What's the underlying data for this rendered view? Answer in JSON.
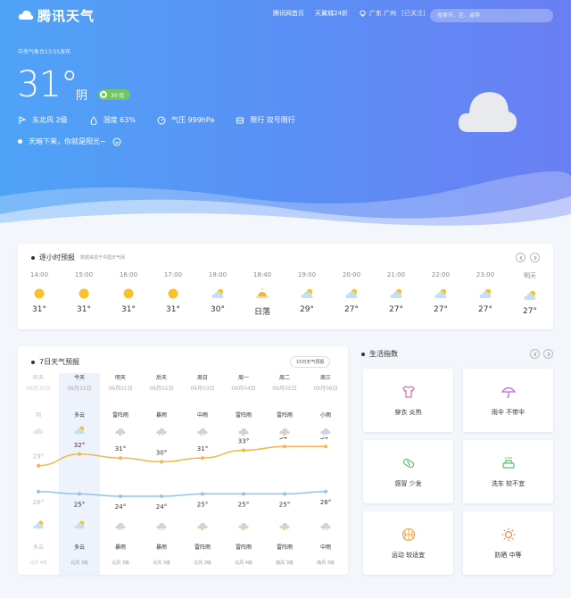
{
  "header": {
    "logo": "腾讯天气",
    "nav": [
      "腾讯网首页",
      "天翼城24折"
    ],
    "location": "广东 广州",
    "followed": "[已关注]",
    "search_placeholder": "搜索市、区、县等"
  },
  "current": {
    "published": "中央气象台13:55发布",
    "temperature": "31°",
    "condition": "阴",
    "aqi": "30 优",
    "wind": "东北风 2级",
    "humidity": "湿度 63%",
    "pressure": "气压 999hPa",
    "limit": "限行 双号限行",
    "tip": "天暗下来，你就是阳光~"
  },
  "hourly": {
    "title": "逐小时预报",
    "source": "数据来源于中国天气网",
    "hours": [
      {
        "time": "14:00",
        "icon": "sun-icon",
        "temp": "31°"
      },
      {
        "time": "15:00",
        "icon": "sun-icon",
        "temp": "31°"
      },
      {
        "time": "16:00",
        "icon": "sun-icon",
        "temp": "31°"
      },
      {
        "time": "17:00",
        "icon": "sun-icon",
        "temp": "31°"
      },
      {
        "time": "18:00",
        "icon": "partly-cloudy-icon",
        "temp": "30°"
      },
      {
        "time": "18:40",
        "icon": "sunset-icon",
        "temp": "日落"
      },
      {
        "time": "19:00",
        "icon": "partly-cloudy-icon",
        "temp": "29°"
      },
      {
        "time": "20:00",
        "icon": "partly-cloudy-icon",
        "temp": "27°"
      },
      {
        "time": "21:00",
        "icon": "partly-cloudy-icon",
        "temp": "27°"
      },
      {
        "time": "22:00",
        "icon": "partly-cloudy-icon",
        "temp": "27°"
      },
      {
        "time": "23:00",
        "icon": "partly-cloudy-icon",
        "temp": "27°"
      },
      {
        "time": "明天",
        "icon": "partly-cloudy-icon",
        "temp": "27°"
      }
    ]
  },
  "daily": {
    "title": "7日天气预报",
    "more": "15日天气预报",
    "days": [
      {
        "name": "昨天",
        "date": "08月30日",
        "day_weather": "阴",
        "day_icon": "cloud-icon",
        "high": "29°",
        "low": "26°",
        "night_icon": "partly-cloudy-icon",
        "night_weather": "多云",
        "wind": "北风 4级",
        "past": true
      },
      {
        "name": "今天",
        "date": "08月31日",
        "day_weather": "多云",
        "day_icon": "partly-cloudy-icon",
        "high": "32°",
        "low": "25°",
        "night_icon": "partly-cloudy-icon",
        "night_weather": "多云",
        "wind": "北风 3级",
        "past": false
      },
      {
        "name": "明天",
        "date": "09月01日",
        "day_weather": "雷阵雨",
        "day_icon": "thunder-icon",
        "high": "31°",
        "low": "24°",
        "night_icon": "rain-icon",
        "night_weather": "暴雨",
        "wind": "北风 3级",
        "past": false
      },
      {
        "name": "后天",
        "date": "09月02日",
        "day_weather": "暴雨",
        "day_icon": "rain-icon",
        "high": "30°",
        "low": "24°",
        "night_icon": "rain-icon",
        "night_weather": "暴雨",
        "wind": "北风 3级",
        "past": false
      },
      {
        "name": "周日",
        "date": "09月03日",
        "day_weather": "中雨",
        "day_icon": "rain-icon",
        "high": "31°",
        "low": "25°",
        "night_icon": "thunder-icon",
        "night_weather": "雷阵雨",
        "wind": "北风 3级",
        "past": false
      },
      {
        "name": "周一",
        "date": "09月04日",
        "day_weather": "雷阵雨",
        "day_icon": "thunder-icon",
        "high": "33°",
        "low": "25°",
        "night_icon": "thunder-icon",
        "night_weather": "雷阵雨",
        "wind": "北风 4级",
        "past": false
      },
      {
        "name": "周二",
        "date": "09月05日",
        "day_weather": "雷阵雨",
        "day_icon": "thunder-icon",
        "high": "34°",
        "low": "25°",
        "night_icon": "thunder-icon",
        "night_weather": "雷阵雨",
        "wind": "南风 3级",
        "past": false
      },
      {
        "name": "周三",
        "date": "09月06日",
        "day_weather": "小雨",
        "day_icon": "rain-icon",
        "high": "34°",
        "low": "26°",
        "night_icon": "rain-icon",
        "night_weather": "中雨",
        "wind": "南风 3级",
        "past": false
      }
    ],
    "high_color": "#f5b54c",
    "low_color": "#8cc5ee"
  },
  "life": {
    "title": "生活指数",
    "items": [
      {
        "label": "穿衣 炎热",
        "icon": "shirt-icon",
        "color": "#e36aa0"
      },
      {
        "label": "雨伞 不带伞",
        "icon": "umbrella-icon",
        "color": "#b56ad8"
      },
      {
        "label": "感冒 少发",
        "icon": "pill-icon",
        "color": "#5cc06a"
      },
      {
        "label": "洗车 较不宜",
        "icon": "car-wash-icon",
        "color": "#5cc06a"
      },
      {
        "label": "运动 较适宜",
        "icon": "basketball-icon",
        "color": "#f0a94b"
      },
      {
        "label": "防晒 中等",
        "icon": "sun-outline-icon",
        "color": "#f08a4b"
      }
    ]
  }
}
